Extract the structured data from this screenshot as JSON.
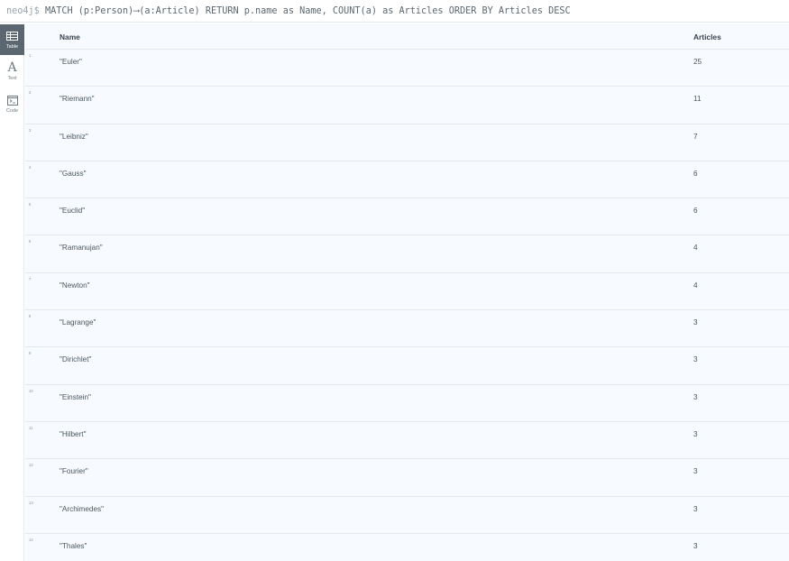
{
  "query_bar": {
    "prompt": "neo4j$",
    "query": "MATCH (p:Person)⟶(a:Article) RETURN p.name as Name, COUNT(a) as Articles ORDER BY Articles DESC"
  },
  "sidebar": {
    "items": [
      {
        "label": "Table",
        "icon": "table-icon",
        "active": true
      },
      {
        "label": "Text",
        "icon": "text-icon",
        "glyph": "A",
        "active": false
      },
      {
        "label": "Code",
        "icon": "code-icon",
        "active": false
      }
    ]
  },
  "table": {
    "columns": [
      "Name",
      "Articles"
    ],
    "rows": [
      {
        "index": "1",
        "name": "\"Euler\"",
        "articles": "25"
      },
      {
        "index": "2",
        "name": "\"Riemann\"",
        "articles": "11"
      },
      {
        "index": "3",
        "name": "\"Leibniz\"",
        "articles": "7"
      },
      {
        "index": "4",
        "name": "\"Gauss\"",
        "articles": "6"
      },
      {
        "index": "5",
        "name": "\"Euclid\"",
        "articles": "6"
      },
      {
        "index": "6",
        "name": "\"Ramanujan\"",
        "articles": "4"
      },
      {
        "index": "7",
        "name": "\"Newton\"",
        "articles": "4"
      },
      {
        "index": "8",
        "name": "\"Lagrange\"",
        "articles": "3"
      },
      {
        "index": "9",
        "name": "\"Dirichlet\"",
        "articles": "3"
      },
      {
        "index": "10",
        "name": "\"Einstein\"",
        "articles": "3"
      },
      {
        "index": "11",
        "name": "\"Hilbert\"",
        "articles": "3"
      },
      {
        "index": "12",
        "name": "\"Fourier\"",
        "articles": "3"
      },
      {
        "index": "13",
        "name": "\"Archimedes\"",
        "articles": "3"
      },
      {
        "index": "14",
        "name": "\"Thales\"",
        "articles": "3"
      }
    ]
  },
  "colors": {
    "sidebar_active": "#5b6770",
    "table_background": "#f7fbff",
    "row_divider": "#e3e8ee"
  }
}
